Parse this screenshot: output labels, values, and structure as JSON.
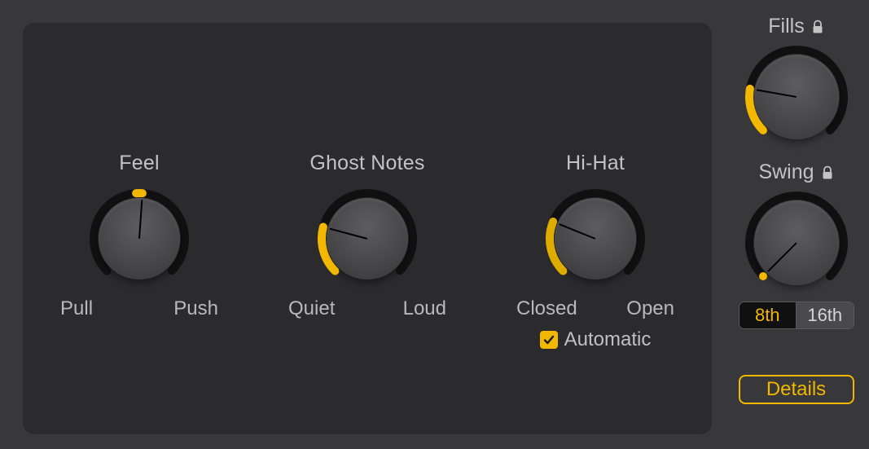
{
  "colors": {
    "accent": "#f2b700",
    "track": "#111111"
  },
  "main": {
    "feel": {
      "title": "Feel",
      "left_label": "Pull",
      "right_label": "Push",
      "angle_deg": 4,
      "arc_start_deg": -4,
      "arc_end_deg": 4
    },
    "ghost_notes": {
      "title": "Ghost Notes",
      "left_label": "Quiet",
      "right_label": "Loud",
      "angle_deg": -75,
      "arc_start_deg": -135,
      "arc_end_deg": -75
    },
    "hi_hat": {
      "title": "Hi-Hat",
      "left_label": "Closed",
      "right_label": "Open",
      "angle_deg": -68,
      "arc_start_deg": -135,
      "arc_end_deg": -68,
      "automatic": {
        "checked": true,
        "label": "Automatic"
      }
    }
  },
  "sidebar": {
    "fills": {
      "title": "Fills",
      "locked": true,
      "angle_deg": -80,
      "arc_start_deg": -135,
      "arc_end_deg": -80
    },
    "swing": {
      "title": "Swing",
      "locked": true,
      "angle_deg": -135,
      "arc_start_deg": -135,
      "arc_end_deg": -135,
      "segments": {
        "options": [
          "8th",
          "16th"
        ],
        "active_index": 0,
        "opt0": "8th",
        "opt1": "16th"
      }
    },
    "details_label": "Details"
  }
}
